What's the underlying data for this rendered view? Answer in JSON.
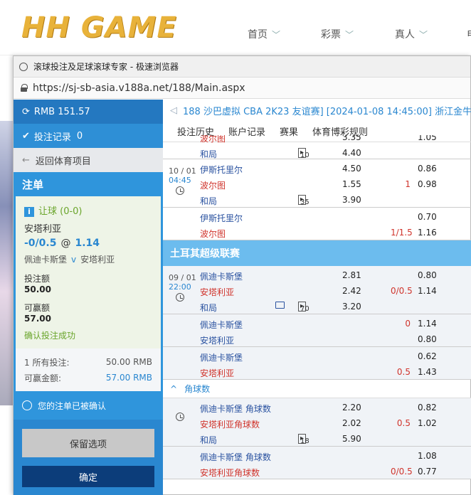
{
  "site": {
    "logo": "HH GAME",
    "nav": [
      "首页",
      "彩票",
      "真人",
      "电"
    ]
  },
  "window": {
    "title": "滚球投注及足球滚球专家 - 极速浏览器",
    "url": "https://sj-sb-asia.v188a.net/188/Main.aspx"
  },
  "slip": {
    "balance": "RMB 151.57",
    "records_label": "投注记录",
    "records_count": "0",
    "back_label": "返回体育项目",
    "title": "注单",
    "handicap": "让球 (0-0)",
    "pick": "安塔利亚",
    "line": "-0/0.5",
    "at": "@",
    "odds": "1.14",
    "home": "佩迪卡斯堡",
    "vs": "v",
    "away": "安塔利亚",
    "stake_label": "投注额",
    "stake_value": "50.00",
    "win_label": "可赢额",
    "win_value": "57.00",
    "confirmed": "确认投注成功",
    "total_bets_label": "1  所有投注:",
    "total_bets_value": "50.00   RMB",
    "total_win_label": "可赢金额:",
    "total_win_value": "57.00   RMB",
    "accepted": "您的注单已被确认",
    "keep_button": "保留选项",
    "ok_button": "确定"
  },
  "main": {
    "event_title": "188 沙巴虚拟 CBA 2K23 友谊赛] [2024-01-08 14:45:00] 浙江金牛",
    "tabs": [
      "投注历史",
      "账户记录",
      "赛果",
      "体育博彩规则"
    ],
    "top_partial": {
      "team": "波尔图",
      "o1": "3.35",
      "o2": "1.05"
    },
    "top_draw": {
      "team": "和局",
      "badge": "10",
      "o1": "4.40"
    },
    "match1": {
      "date": "10 / 01",
      "time": "04:45",
      "rows": [
        {
          "team": "伊斯托里尔",
          "o1": "4.50",
          "hcp": "",
          "o2": "0.86"
        },
        {
          "team": "波尔图",
          "o1": "1.55",
          "hcp": "1",
          "o2": "0.98"
        },
        {
          "team": "和局",
          "badge": "35",
          "o1": "3.90",
          "hcp": "",
          "o2": ""
        }
      ]
    },
    "match1b": [
      {
        "team": "伊斯托里尔",
        "hcp": "",
        "o2": "0.70"
      },
      {
        "team": "波尔图",
        "hcp": "1/1.5",
        "o2": "1.16"
      }
    ],
    "league": "土耳其超级联赛",
    "match2": {
      "date": "09 / 01",
      "time": "22:00",
      "rows": [
        {
          "team": "佩迪卡斯堡",
          "o1": "2.81",
          "hcp": "",
          "o2": "0.80"
        },
        {
          "team": "安塔利亚",
          "o1": "2.42",
          "hcp": "0/0.5",
          "o2": "1.14"
        },
        {
          "team": "和局",
          "badge": "70",
          "o1": "3.20",
          "hcp": "",
          "o2": ""
        }
      ]
    },
    "match2b": [
      {
        "team": "佩迪卡斯堡",
        "hcp": "0",
        "o2": "1.14"
      },
      {
        "team": "安塔利亚",
        "hcp": "",
        "o2": "0.80"
      }
    ],
    "match2c": [
      {
        "team": "佩迪卡斯堡",
        "hcp": "",
        "o2": "0.62"
      },
      {
        "team": "安塔利亚",
        "hcp": "0.5",
        "o2": "1.43"
      }
    ],
    "corners_label": "角球数",
    "corners1": [
      {
        "team": "佩迪卡斯堡 角球数",
        "o1": "2.20",
        "hcp": "",
        "o2": "0.82"
      },
      {
        "team": "安塔利亚角球数",
        "o1": "2.02",
        "hcp": "0.5",
        "o2": "1.02"
      },
      {
        "team": "和局",
        "badge": "18",
        "o1": "5.90",
        "hcp": "",
        "o2": ""
      }
    ],
    "corners2": [
      {
        "team": "佩迪卡斯堡 角球数",
        "hcp": "",
        "o2": "1.08"
      },
      {
        "team": "安塔利亚角球数",
        "hcp": "0/0.5",
        "o2": "0.77"
      }
    ]
  }
}
